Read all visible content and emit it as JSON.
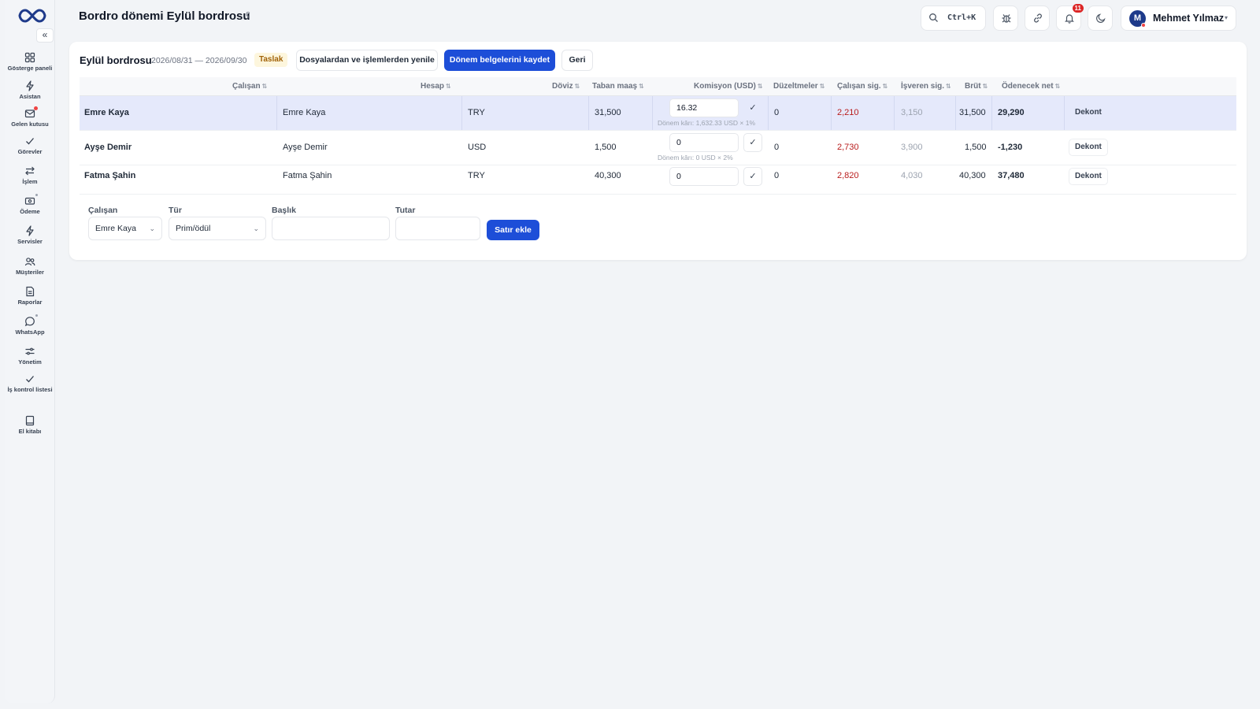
{
  "app": {
    "page_title": "Bordro dönemi Eylül bordrosu",
    "title_glyph": "ʕ"
  },
  "sidebar": {
    "collapse_glyph": "«",
    "items": [
      {
        "label": "Gösterge paneli",
        "icon": "dashboard-icon"
      },
      {
        "label": "Asistan",
        "icon": "bolt-icon"
      },
      {
        "label": "Gelen kutusu",
        "icon": "inbox-icon",
        "dot": true
      },
      {
        "label": "Görevler",
        "icon": "check-icon"
      },
      {
        "label": "İşlem",
        "icon": "swap-icon"
      },
      {
        "label": "Ödeme",
        "icon": "payment-icon",
        "dot": true
      },
      {
        "label": "Servisler",
        "icon": "bolt-icon"
      },
      {
        "label": "Müşteriler",
        "icon": "users-icon"
      },
      {
        "label": "Raporlar",
        "icon": "report-icon"
      },
      {
        "label": "WhatsApp",
        "icon": "chat-icon",
        "dot": true
      },
      {
        "label": "Yönetim",
        "icon": "sliders-icon"
      },
      {
        "label": "İş kontrol listesi",
        "icon": "check-icon"
      },
      {
        "label": "El kitabı",
        "icon": "book-icon"
      }
    ]
  },
  "header": {
    "search_shortcut": "Ctrl+K",
    "notification_count": "11",
    "user": {
      "initial": "M",
      "name": "Mehmet Yılmaz",
      "caret": "▾"
    }
  },
  "payroll": {
    "title": "Eylül bordrosu",
    "dates": "2026/08/31 — 2026/09/30",
    "status": "Taslak",
    "buttons": {
      "refresh": "Dosyalardan ve işlemlerden yenile",
      "save": "Dönem belgelerini kaydet",
      "back": "Geri"
    },
    "columns": [
      "Çalışan",
      "Hesap",
      "Döviz",
      "Taban maaş",
      "Komisyon (USD)",
      "Düzeltmeler",
      "Çalışan sig.",
      "İşveren sig.",
      "Brüt",
      "Ödenecek net"
    ],
    "sort_glyph": "⇅",
    "rows": [
      {
        "employee": "Emre Kaya",
        "account": "Emre Kaya",
        "currency": "TRY",
        "base_salary": "31,500",
        "commission": "16.32",
        "commission_note": "Dönem kârı: 1,632.33 USD × 1%",
        "adjustments": "0",
        "employee_ins": "2,210",
        "employer_ins": "3,150",
        "gross": "31,500",
        "net": "29,290",
        "slip": "Dekont",
        "selected": true
      },
      {
        "employee": "Ayşe Demir",
        "account": "Ayşe Demir",
        "currency": "USD",
        "base_salary": "1,500",
        "commission": "0",
        "commission_note": "Dönem kârı: 0 USD × 2%",
        "adjustments": "0",
        "employee_ins": "2,730",
        "employer_ins": "3,900",
        "gross": "1,500",
        "net": "-1,230",
        "slip": "Dekont"
      },
      {
        "employee": "Fatma Şahin",
        "account": "Fatma Şahin",
        "currency": "TRY",
        "base_salary": "40,300",
        "commission": "0",
        "commission_note": "",
        "adjustments": "0",
        "employee_ins": "2,820",
        "employer_ins": "4,030",
        "gross": "40,300",
        "net": "37,480",
        "slip": "Dekont"
      }
    ],
    "check_glyph": "✓"
  },
  "add_line": {
    "labels": {
      "employee": "Çalışan",
      "type": "Tür",
      "heading": "Başlık",
      "amount": "Tutar"
    },
    "employee_value": "Emre Kaya",
    "type_value": "Prim/ödül",
    "heading_value": "",
    "amount_value": "",
    "submit": "Satır ekle"
  },
  "colors": {
    "accent": "#1d4ed8",
    "selected_row": "#e5e9fb",
    "negative_red": "#b91c1c",
    "status_bg": "#fdf6dd",
    "status_text": "#a16207"
  }
}
